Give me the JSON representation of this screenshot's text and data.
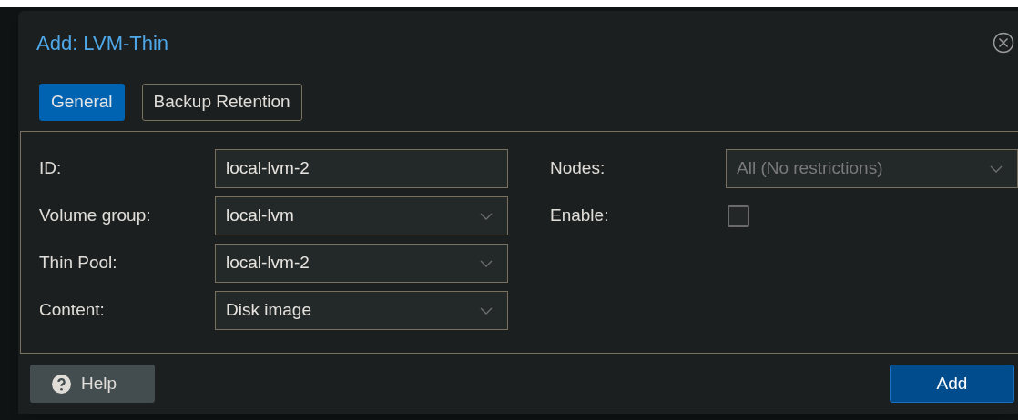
{
  "dialog": {
    "title": "Add: LVM-Thin"
  },
  "tabs": [
    {
      "label": "General",
      "selected": true
    },
    {
      "label": "Backup Retention",
      "selected": false
    }
  ],
  "left_fields": [
    {
      "label": "ID:",
      "kind": "text",
      "value": "local-lvm-2",
      "disabled": false
    },
    {
      "label": "Volume group:",
      "kind": "combo",
      "value": "local-lvm",
      "disabled": false
    },
    {
      "label": "Thin Pool:",
      "kind": "combo",
      "value": "local-lvm-2",
      "disabled": false
    },
    {
      "label": "Content:",
      "kind": "combo",
      "value": "Disk image",
      "disabled": false
    }
  ],
  "right_fields": [
    {
      "label": "Nodes:",
      "kind": "combo",
      "value": "All (No restrictions)",
      "disabled": true
    },
    {
      "label": "Enable:",
      "kind": "checkbox",
      "checked": false
    }
  ],
  "footer": {
    "help_button": "Help",
    "add_button": "Add"
  }
}
